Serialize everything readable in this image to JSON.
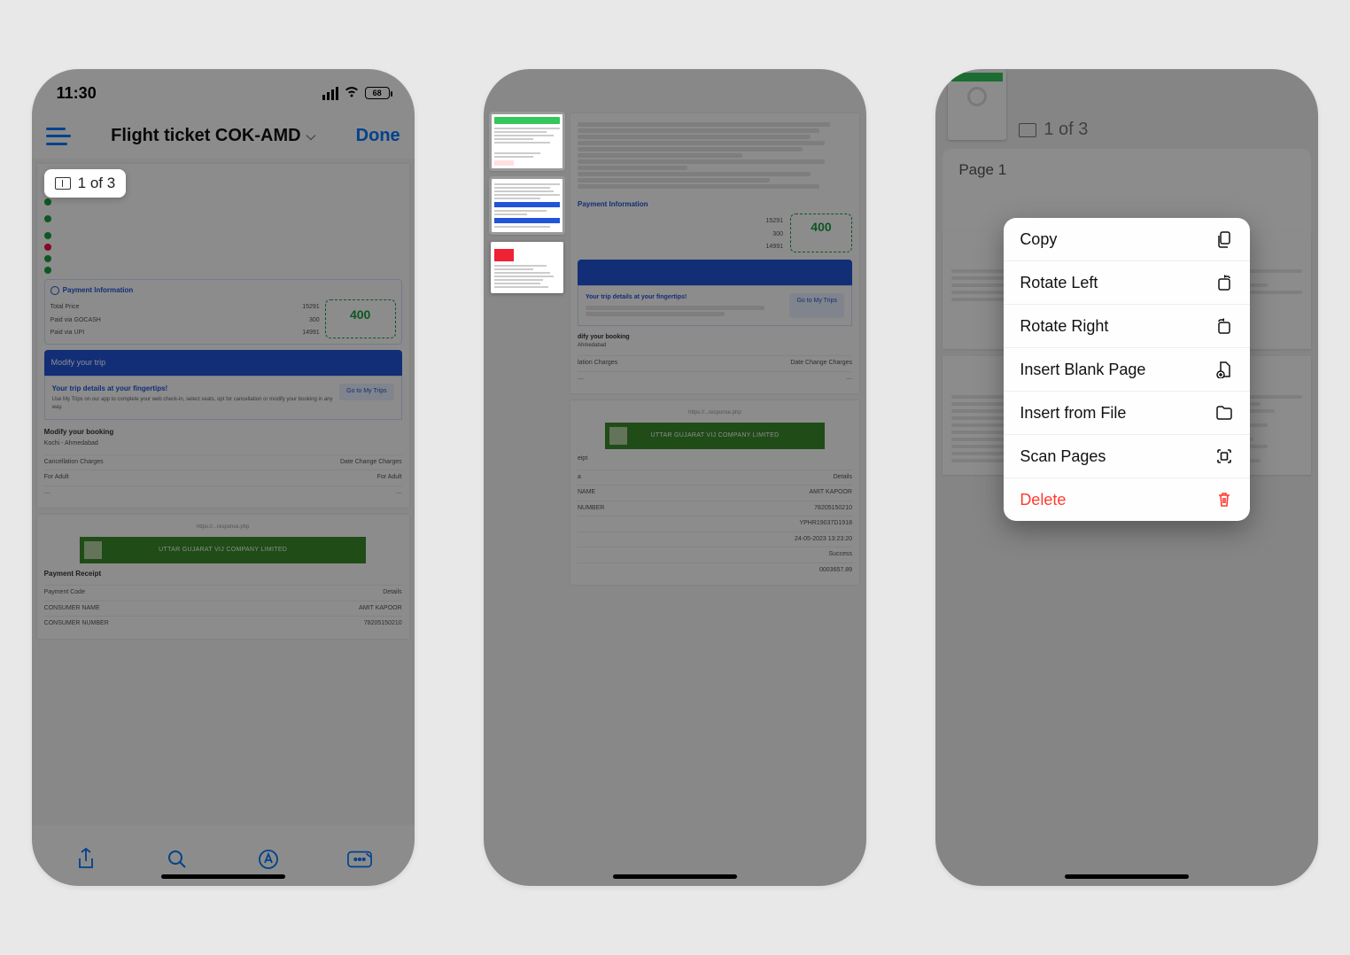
{
  "statusbar": {
    "time": "11:30",
    "battery": "68"
  },
  "header": {
    "title": "Flight ticket COK-AMD",
    "done_label": "Done"
  },
  "page_indicator": "1 of 3",
  "sheet1": {
    "payment_heading": "Payment Information",
    "total_label": "Total Price",
    "gocash_label": "Paid via GOCASH",
    "upi_label": "Paid via UPI",
    "total_value": "15291",
    "gocash_value": "300",
    "upi_value": "14991",
    "big_amount": "400",
    "modify_strip": "Modify your trip",
    "fingertips_title": "Your trip details at your fingertips!",
    "fingertips_sub": "Use My Trips on our app to complete your web check-in, select seats, opt for cancellation or modify your booking in any way.",
    "go_trips_btn": "Go to My Trips",
    "modify_booking": "Modify your booking",
    "route": "Kochi - Ahmedabad",
    "cancel_charges": "Cancellation Charges",
    "date_charges": "Date Change Charges",
    "for_adult": "For Adult",
    "banner_text": "UTTAR GUJARAT VIJ COMPANY LIMITED",
    "receipt_title": "Payment Receipt",
    "payment_code": "Payment Code",
    "details": "Details",
    "con_name": "CONSUMER NAME",
    "con_name_val": "AMIT KAPOOR",
    "con_num": "CONSUMER NUMBER",
    "con_num_val": "78205150210"
  },
  "p3": {
    "page_indicator": "1 of 3",
    "page_label": "Page 1"
  },
  "context_menu": {
    "copy": "Copy",
    "rotate_left": "Rotate Left",
    "rotate_right": "Rotate Right",
    "insert_blank": "Insert Blank Page",
    "insert_file": "Insert from File",
    "scan": "Scan Pages",
    "delete": "Delete"
  }
}
